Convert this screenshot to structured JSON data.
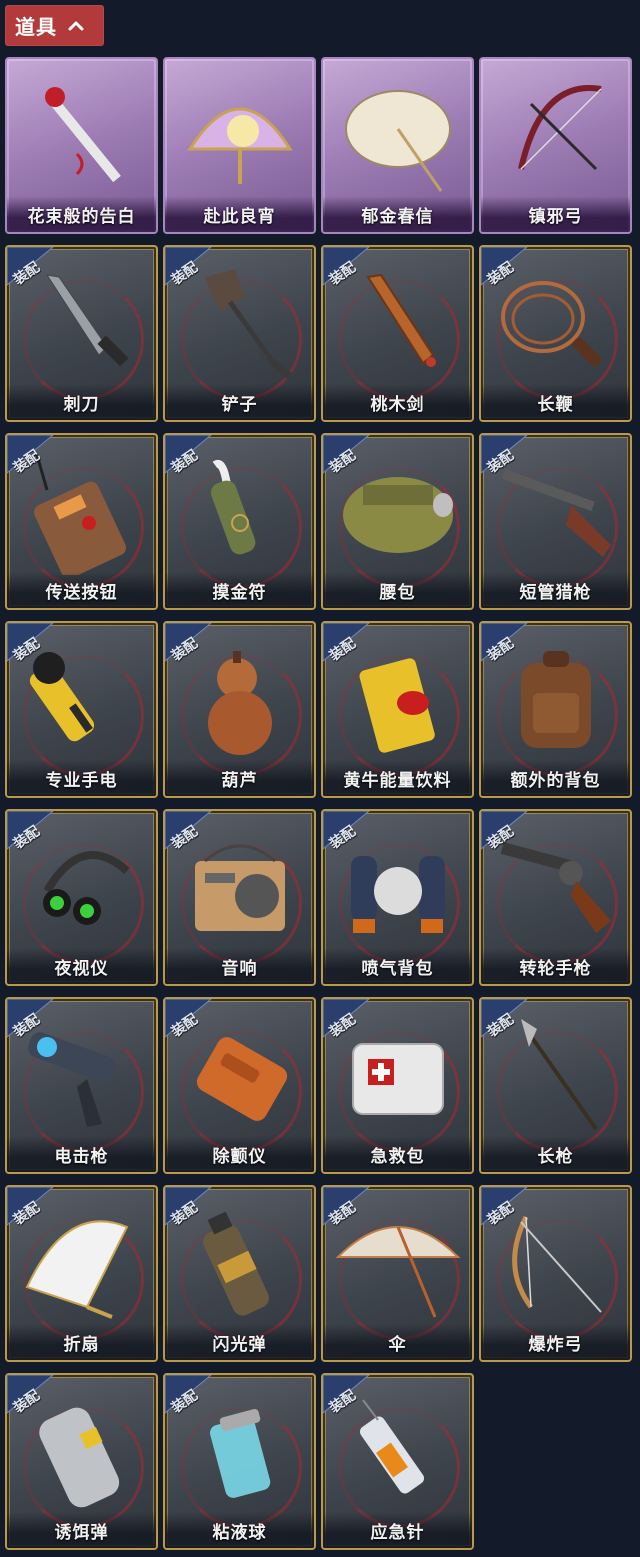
{
  "header": {
    "label": "道具",
    "icon": "chevron-up-icon"
  },
  "badge_label": "装配",
  "colors": {
    "header_bg": "#b23a3a",
    "page_bg": "#131a2a",
    "gold_border": "#b89a4a",
    "purple_card": "#9c7bb3"
  },
  "items": [
    {
      "name": "花束般的告白",
      "rarity": "purple",
      "equipped": false,
      "icon": "rose-bouquet-icon"
    },
    {
      "name": "赴此良宵",
      "rarity": "purple",
      "equipped": false,
      "icon": "moon-fan-icon"
    },
    {
      "name": "郁金春信",
      "rarity": "purple",
      "equipped": false,
      "icon": "parasol-icon"
    },
    {
      "name": "镇邪弓",
      "rarity": "purple",
      "equipped": false,
      "icon": "bow-icon"
    },
    {
      "name": "刺刀",
      "rarity": "gold",
      "equipped": true,
      "icon": "dagger-icon"
    },
    {
      "name": "铲子",
      "rarity": "gold",
      "equipped": true,
      "icon": "shovel-icon"
    },
    {
      "name": "桃木剑",
      "rarity": "gold",
      "equipped": true,
      "icon": "wooden-sword-icon"
    },
    {
      "name": "长鞭",
      "rarity": "gold",
      "equipped": true,
      "icon": "whip-icon"
    },
    {
      "name": "传送按钮",
      "rarity": "gold",
      "equipped": true,
      "icon": "remote-button-icon"
    },
    {
      "name": "摸金符",
      "rarity": "gold",
      "equipped": true,
      "icon": "talisman-icon"
    },
    {
      "name": "腰包",
      "rarity": "gold",
      "equipped": true,
      "icon": "waist-bag-icon"
    },
    {
      "name": "短管猎枪",
      "rarity": "gold",
      "equipped": true,
      "icon": "shotgun-icon"
    },
    {
      "name": "专业手电",
      "rarity": "gold",
      "equipped": true,
      "icon": "flashlight-icon"
    },
    {
      "name": "葫芦",
      "rarity": "gold",
      "equipped": true,
      "icon": "gourd-icon"
    },
    {
      "name": "黄牛能量饮料",
      "rarity": "gold",
      "equipped": true,
      "icon": "energy-drink-icon"
    },
    {
      "name": "额外的背包",
      "rarity": "gold",
      "equipped": true,
      "icon": "backpack-icon"
    },
    {
      "name": "夜视仪",
      "rarity": "gold",
      "equipped": true,
      "icon": "night-vision-icon"
    },
    {
      "name": "音响",
      "rarity": "gold",
      "equipped": true,
      "icon": "radio-icon"
    },
    {
      "name": "喷气背包",
      "rarity": "gold",
      "equipped": true,
      "icon": "jetpack-icon"
    },
    {
      "name": "转轮手枪",
      "rarity": "gold",
      "equipped": true,
      "icon": "revolver-icon"
    },
    {
      "name": "电击枪",
      "rarity": "gold",
      "equipped": true,
      "icon": "stun-gun-icon"
    },
    {
      "name": "除颤仪",
      "rarity": "gold",
      "equipped": true,
      "icon": "defibrillator-icon"
    },
    {
      "name": "急救包",
      "rarity": "gold",
      "equipped": true,
      "icon": "first-aid-kit-icon"
    },
    {
      "name": "长枪",
      "rarity": "gold",
      "equipped": true,
      "icon": "spear-icon"
    },
    {
      "name": "折扇",
      "rarity": "gold",
      "equipped": true,
      "icon": "folding-fan-icon"
    },
    {
      "name": "闪光弹",
      "rarity": "gold",
      "equipped": true,
      "icon": "flash-grenade-icon"
    },
    {
      "name": "伞",
      "rarity": "gold",
      "equipped": true,
      "icon": "umbrella-icon"
    },
    {
      "name": "爆炸弓",
      "rarity": "gold",
      "equipped": true,
      "icon": "explosive-bow-icon"
    },
    {
      "name": "诱饵弹",
      "rarity": "gold",
      "equipped": true,
      "icon": "decoy-canister-icon"
    },
    {
      "name": "粘液球",
      "rarity": "gold",
      "equipped": true,
      "icon": "slime-vial-icon"
    },
    {
      "name": "应急针",
      "rarity": "gold",
      "equipped": true,
      "icon": "syringe-icon"
    }
  ]
}
